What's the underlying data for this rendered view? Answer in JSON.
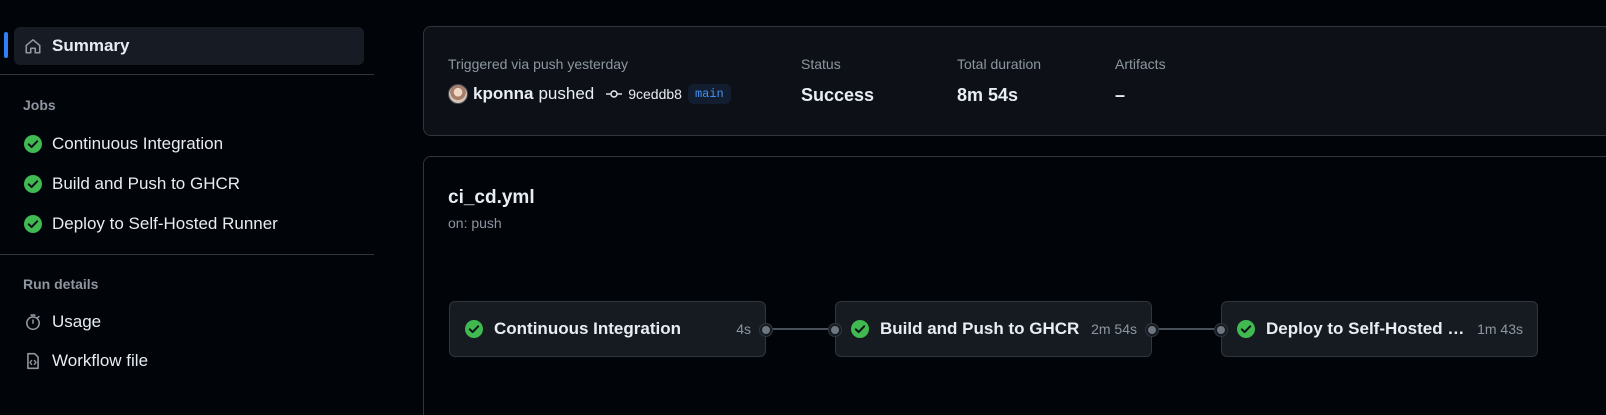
{
  "sidebar": {
    "summary_label": "Summary",
    "jobs_heading": "Jobs",
    "jobs": [
      {
        "label": "Continuous Integration",
        "status": "success"
      },
      {
        "label": "Build and Push to GHCR",
        "status": "success"
      },
      {
        "label": "Deploy to Self-Hosted Runner",
        "status": "success"
      }
    ],
    "run_details_heading": "Run details",
    "run_details": [
      {
        "label": "Usage",
        "icon": "stopwatch-icon"
      },
      {
        "label": "Workflow file",
        "icon": "file-code-icon"
      }
    ]
  },
  "summary": {
    "trigger_label": "Triggered via push yesterday",
    "user": "kponna",
    "action": "pushed",
    "commit_sha": "9ceddb8",
    "branch": "main",
    "status_label": "Status",
    "status_value": "Success",
    "duration_label": "Total duration",
    "duration_value": "8m 54s",
    "artifacts_label": "Artifacts",
    "artifacts_value": "–"
  },
  "workflow": {
    "file": "ci_cd.yml",
    "trigger": "on: push",
    "jobs": [
      {
        "name": "Continuous Integration",
        "duration": "4s"
      },
      {
        "name": "Build and Push to GHCR",
        "duration": "2m 54s"
      },
      {
        "name": "Deploy to Self-Hosted R...",
        "duration": "1m 43s"
      }
    ]
  },
  "colors": {
    "background": "#010409",
    "success": "#3fb950",
    "accent": "#2f81f7",
    "text": "#e6edf3",
    "muted": "#8d96a0"
  }
}
